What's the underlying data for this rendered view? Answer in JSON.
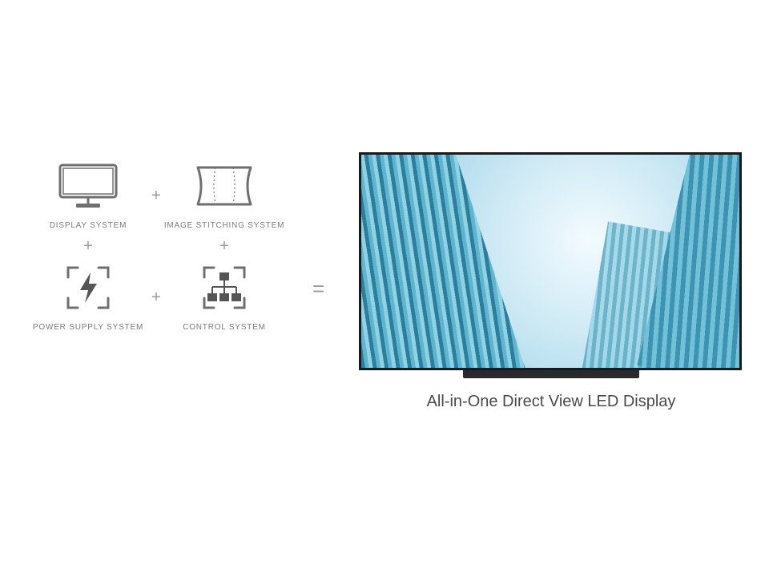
{
  "systems": {
    "display": {
      "label": "DISPLAY SYSTEM"
    },
    "stitching": {
      "label": "IMAGE STITCHING SYSTEM"
    },
    "power": {
      "label": "POWER SUPPLY SYSTEM"
    },
    "control": {
      "label": "CONTROL SYSTEM"
    }
  },
  "operators": {
    "plus": "+",
    "equals": "="
  },
  "result": {
    "caption": "All-in-One Direct View LED Display"
  }
}
